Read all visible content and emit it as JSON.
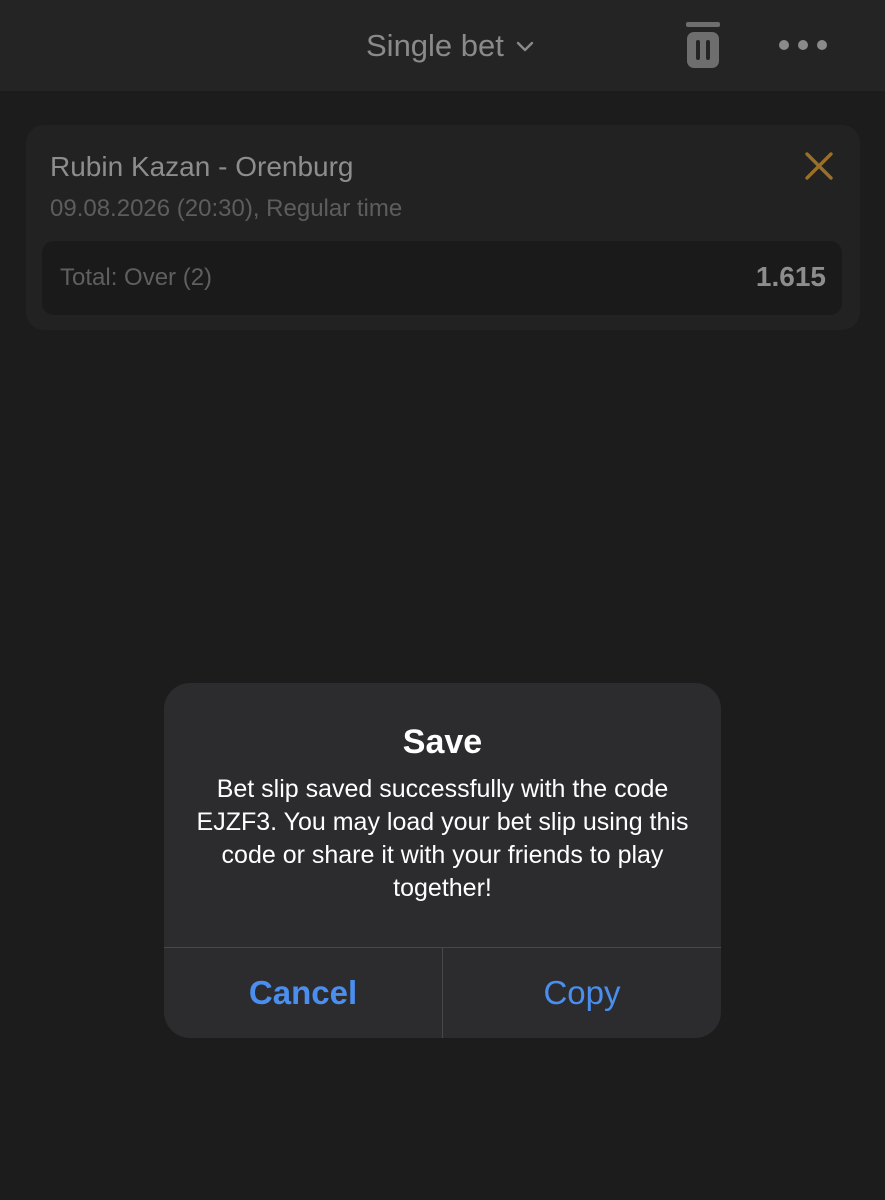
{
  "header": {
    "title": "Single bet",
    "icons": [
      "chevron-down-icon",
      "trash-icon",
      "more-icon"
    ]
  },
  "bet": {
    "match": "Rubin Kazan - Orenburg",
    "datetime": "09.08.2026 (20:30), Regular time",
    "outcome": "Total: Over (2)",
    "odds": "1.615",
    "close_icon": "close-icon"
  },
  "dialog": {
    "title": "Save",
    "message": "Bet slip saved successfully with the code EJZF3. You may load your bet slip using this code or share it with your friends to play together!",
    "cancel_label": "Cancel",
    "copy_label": "Copy"
  },
  "colors": {
    "background": "#1c1c1c",
    "header": "#242424",
    "card": "#222222",
    "close_accent": "#9a6f2a",
    "dialog": "#2c2c2e",
    "button_blue": "#4a8ff0"
  }
}
